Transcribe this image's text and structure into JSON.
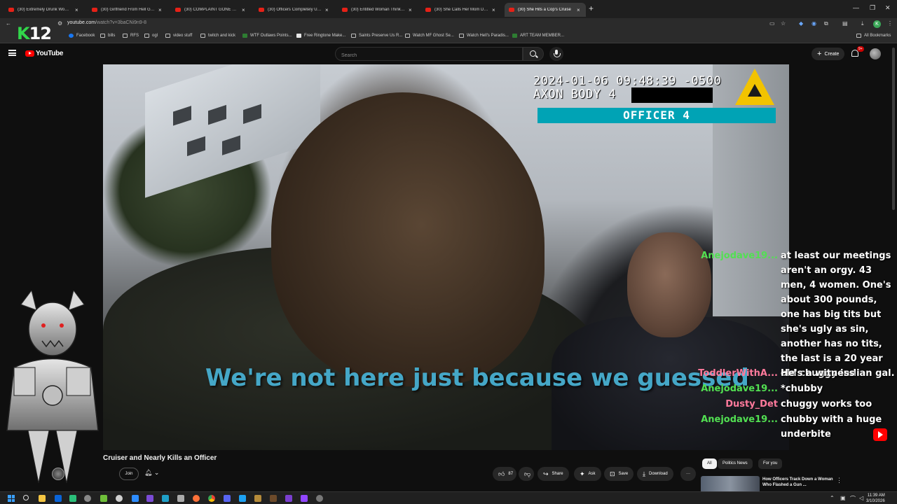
{
  "browser": {
    "tabs": [
      {
        "label": "(30) Extremely Drunk Woman D",
        "active": false
      },
      {
        "label": "(30) Girlfriend From Hell Gets",
        "active": false
      },
      {
        "label": "(30) COMPLAINT GONE WRON",
        "active": false
      },
      {
        "label": "(30) Officers Completely Unpr",
        "active": false
      },
      {
        "label": "(30) Entitled Woman Thinks She",
        "active": false
      },
      {
        "label": "(30) She Calls Her Mom During",
        "active": false
      },
      {
        "label": "(30) She Hits a Cop's Cruise",
        "active": true
      }
    ],
    "url_host": "youtube.com",
    "url_path": "/watch?v=3baCNi9n9-8",
    "profile_initial": "K",
    "bookmarks": [
      {
        "label": "Facebook",
        "icon": "facebook-icon"
      },
      {
        "label": "bills",
        "icon": "folder-icon"
      },
      {
        "label": "RFS",
        "icon": "folder-icon"
      },
      {
        "label": "ogl",
        "icon": "folder-icon"
      },
      {
        "label": "video stuff",
        "icon": "folder-icon"
      },
      {
        "label": "twitch and kick",
        "icon": "folder-icon"
      },
      {
        "label": "WTF Outlaws Points...",
        "icon": "site-icon"
      },
      {
        "label": "Free Ringtone Make...",
        "icon": "download-icon"
      },
      {
        "label": "Saints Preserve Us R...",
        "icon": "globe-icon"
      },
      {
        "label": "Watch MF Ghost Se...",
        "icon": "globe-icon"
      },
      {
        "label": "Watch Hell's Paradis...",
        "icon": "globe-icon"
      },
      {
        "label": "ART TEAM MEMBER...",
        "icon": "site-icon"
      }
    ],
    "all_bookmarks_label": "All Bookmarks"
  },
  "overlay_logo": {
    "k": "K",
    "number": "12"
  },
  "youtube": {
    "logo_text": "YouTube",
    "search_placeholder": "Search",
    "create_label": "Create",
    "notif_count": "9+"
  },
  "video": {
    "timestamp": "2024-01-06 09:48:39 -0500",
    "camera_model": "AXON BODY 4",
    "officer_label": "OFFICER 4",
    "caption": "We're not here just because we guessed"
  },
  "chat": [
    {
      "user": "Anejodave19...",
      "color": "#52e052",
      "message": "at least our meetings aren't an orgy. 43 men, 4 women. One's about 300 pounds, one has big tits but she's ugly as sin, another has no tits, the last is a 20 year old chuggy indian gal."
    },
    {
      "user": "ToddlerWithA...",
      "color": "#ff7a9c",
      "message": "He's a witness"
    },
    {
      "user": "Anejodave19...",
      "color": "#52e052",
      "message": "*chubby"
    },
    {
      "user": "Dusty_Det",
      "color": "#ff7a9c",
      "message": "chuggy works too"
    },
    {
      "user": "Anejodave19...",
      "color": "#52e052",
      "message": "chubby with a huge underbite"
    }
  ],
  "below": {
    "title": "Cruiser and Nearly Kills an Officer",
    "join_label": "Join",
    "like_count": "87",
    "share_label": "Share",
    "ask_label": "Ask",
    "save_label": "Save",
    "download_label": "Download",
    "chips": [
      "All",
      "Politics News",
      "For you"
    ],
    "rec_title": "How Officers Track Down a Woman Who Flashed a Gun ..."
  },
  "taskbar": {
    "time": "11:39 AM",
    "date": "3/10/2026"
  },
  "colors": {
    "youtube_red": "#ff0000",
    "officer_bar": "#00a3b5",
    "caption": "#45a7c7",
    "axon_yellow": "#f2c300"
  }
}
